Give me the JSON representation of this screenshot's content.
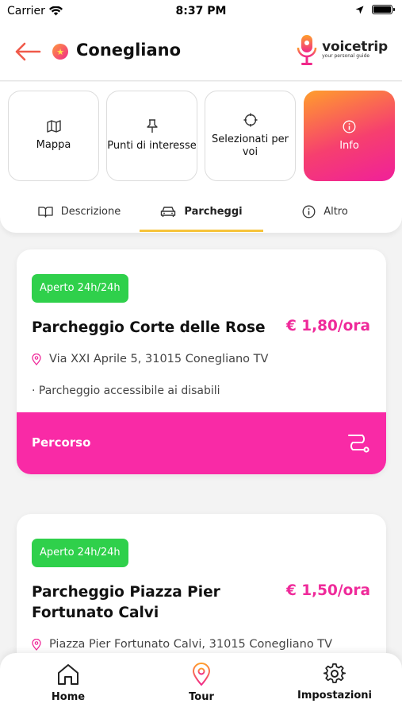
{
  "status_bar": {
    "carrier": "Carrier",
    "time": "8:37 PM"
  },
  "header": {
    "title": "Conegliano",
    "logo": {
      "name": "voicetrip",
      "tagline": "your personal guide"
    }
  },
  "segments": [
    {
      "label": "Mappa",
      "icon": "map-icon"
    },
    {
      "label": "Punti di interesse",
      "icon": "pin-icon"
    },
    {
      "label": "Selezionati per voi",
      "icon": "crosshair-icon"
    },
    {
      "label": "Info",
      "icon": "info-icon",
      "active": true
    }
  ],
  "tabs": [
    {
      "label": "Descrizione",
      "icon": "book-icon"
    },
    {
      "label": "Parcheggi",
      "icon": "car-icon",
      "active": true
    },
    {
      "label": "Altro",
      "icon": "info-icon"
    }
  ],
  "parkings": [
    {
      "badge": "Aperto 24h/24h",
      "name": "Parcheggio Corte delle Rose",
      "price": "€ 1,80/ora",
      "address": "Via XXI Aprile 5, 31015 Conegliano TV",
      "features": "· Parcheggio accessibile ai disabili",
      "route_label": "Percorso"
    },
    {
      "badge": "Aperto 24h/24h",
      "name_line1": "Parcheggio Piazza Pier",
      "name_line2": "Fortunato Calvi",
      "price": "€ 1,50/ora",
      "address": "Piazza Pier Fortunato Calvi, 31015 Conegliano TV"
    }
  ],
  "bottom_nav": [
    {
      "label": "Home",
      "icon": "home-icon"
    },
    {
      "label": "Tour",
      "icon": "location-pin-icon",
      "active": true
    },
    {
      "label": "Impostazioni",
      "icon": "gear-icon"
    }
  ],
  "colors": {
    "accent_pink": "#f92aa6",
    "badge_green": "#2fd04b",
    "tab_underline": "#f6c33a",
    "back_arrow": "#f05a4a"
  }
}
